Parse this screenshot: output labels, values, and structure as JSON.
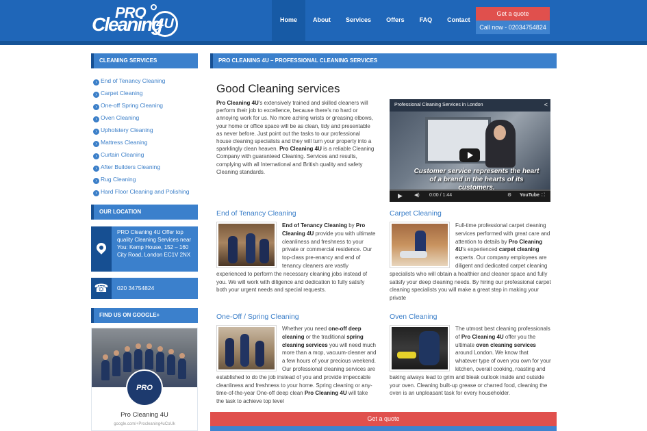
{
  "header": {
    "logo_top": "PRO",
    "logo_main": "Cleaning",
    "logo_badge": "4U",
    "nav": [
      {
        "label": "Home",
        "active": true
      },
      {
        "label": "About"
      },
      {
        "label": "Services"
      },
      {
        "label": "Offers"
      },
      {
        "label": "FAQ"
      },
      {
        "label": "Contact"
      }
    ],
    "quote_label": "Get a quote",
    "call_label": "Call now - 02034754824"
  },
  "sidebar": {
    "services_title": "CLEANING SERVICES",
    "services": [
      "End of Tenancy Cleaning",
      "Carpet Cleaning",
      "One-off Spring Cleaning",
      "Oven Cleaning",
      "Upholstery Cleaning",
      "Mattress Cleaning",
      "Curtain Cleaning",
      "After Builders Cleaning",
      "Rug Cleaning",
      "Hard Floor Cleaning and Polishing"
    ],
    "location_title": "OUR LOCATION",
    "location_text": "PRO Cleaning 4U Offer top quality Cleaning Services near You: Kemp House, 152 – 160 City Road, London EC1V 2NX",
    "phone": "020 34754824",
    "google_title": "FIND US ON GOOGLE+",
    "google_avatar": "PRO Cleaning 4U",
    "google_name": "Pro Cleaning 4U",
    "google_url": "google.com/+Procleaning4uCoUk"
  },
  "main": {
    "heading": "PRO CLEANING 4U – PROFESSIONAL CLEANING SERVICES",
    "title": "Good Cleaning services",
    "intro_b1": "Pro Cleaning 4U",
    "intro_t1": "'s extensively trained and skilled cleaners will perform their job to excellence, because there's no hard or annoying work for us. No more aching wrists or greasing elbows, your home or office space will be as clean, tidy and presentable as never before. Just point out the tasks to our professional house cleaning specialists and they will turn your property into a sparklingly clean heaven. ",
    "intro_b2": "Pro Cleaning 4U",
    "intro_t2": " is a reliable Cleaning Company with guaranteed Cleaning. Services and results, complying with all International and British quality and safety Cleaning standards.",
    "video": {
      "title": "Professional Cleaning Services in London",
      "caption": "Customer service represents the heart of a brand in the hearts of its customers.",
      "time": "0:00 / 1:44",
      "brand": "YouTube"
    },
    "sections": {
      "tenancy": {
        "title": "End of Tenancy Cleaning",
        "b1": "End of Tenancy Cleaning",
        "t1": " by ",
        "b2": "Pro Cleaning 4U",
        "t2": " provide you with ultimate cleanliness and freshness to your private or commercial residence. Our top-class pre-enancy and end of tenancy cleaners are vastly experienced to perform the necessary cleaning jobs instead of you. We will work with diligence and dedication to fully satisfy both your urgent needs and special requests."
      },
      "carpet": {
        "title": "Carpet Cleaning",
        "t1": "Full-time professional carpet cleaning services performed with great care and attention to details by ",
        "b1": "Pro Cleaning 4U",
        "t2": "'s experienced ",
        "b2": "carpet cleaning",
        "t3": " experts. Our company employees are diligent and dedicated carpet cleaning specialists who will obtain a healthier and cleaner space and fully satisfy your deep cleaning needs. By hiring our professional carpet cleaning specialists you will make a great step in making your private"
      },
      "spring": {
        "title": "One-Off / Spring Cleaning",
        "t1": "Whether you need ",
        "b1": "one-off deep cleaning",
        "t2": " or the traditional ",
        "b2": "spring cleaning services",
        "t3": " you will need much more than a mop, vacuum-cleaner and a few hours of your precious weekend. Our professional cleaning services are established to do the job instead of you and provide impeccable cleanliness and freshness to your home. Spring cleaning or any-time-of-the-year One-off deep clean ",
        "b3": "Pro Cleaning 4U",
        "t4": " will take the task to achieve top level"
      },
      "oven": {
        "title": "Oven Cleaning",
        "t1": "The utmost best cleaning professionals of ",
        "b1": "Pro Cleaning 4U",
        "t2": " offer you the ultimate ",
        "b2": "oven cleaning services",
        "t3": " around London. We know that whatever type of oven you own for your kitchen, overall cooking, roasting and baking always lead to grim and bleak outlook inside and outside your oven. Cleaning built-up grease or charred food, cleaning the oven is an unpleasant task for every householder."
      }
    },
    "bottom_quote": "Get a quote"
  }
}
